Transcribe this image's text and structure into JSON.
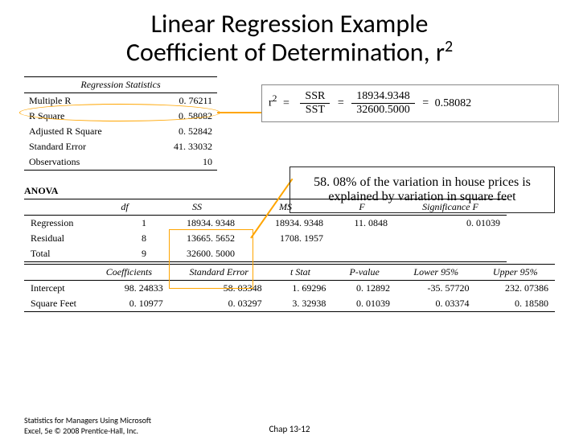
{
  "title_line1": "Linear Regression Example",
  "title_line2_a": "Coefficient of Determination, r",
  "title_line2_sup": "2",
  "stats": {
    "caption": "Regression Statistics",
    "rows": [
      {
        "label": "Multiple R",
        "value": "0. 76211"
      },
      {
        "label": "R Square",
        "value": "0. 58082"
      },
      {
        "label": "Adjusted R Square",
        "value": "0. 52842"
      },
      {
        "label": "Standard Error",
        "value": "41. 33032"
      },
      {
        "label": "Observations",
        "value": "10"
      }
    ]
  },
  "formula": {
    "r2": "r",
    "sup": "2",
    "eq": "=",
    "ssr": "SSR",
    "sst": "SST",
    "num": "18934.9348",
    "den": "32600.5000",
    "res": "0.58082"
  },
  "explain": "58. 08% of the variation in house prices is explained by variation in square feet",
  "anova": {
    "label": "ANOVA",
    "headers": [
      "df",
      "SS",
      "MS",
      "F",
      "Significance F"
    ],
    "rows": [
      {
        "label": "Regression",
        "cells": [
          "1",
          "18934. 9348",
          "18934. 9348",
          "11. 0848",
          "0. 01039"
        ]
      },
      {
        "label": "Residual",
        "cells": [
          "8",
          "13665. 5652",
          "1708. 1957",
          "",
          ""
        ]
      },
      {
        "label": "Total",
        "cells": [
          "9",
          "32600. 5000",
          "",
          "",
          ""
        ]
      }
    ]
  },
  "coef": {
    "headers": [
      "Coefficients",
      "Standard Error",
      "t Stat",
      "P-value",
      "Lower 95%",
      "Upper 95%"
    ],
    "rows": [
      {
        "label": "Intercept",
        "cells": [
          "98. 24833",
          "58. 03348",
          "1. 69296",
          "0. 12892",
          "-35. 57720",
          "232. 07386"
        ]
      },
      {
        "label": "Square Feet",
        "cells": [
          "0. 10977",
          "0. 03297",
          "3. 32938",
          "0. 01039",
          "0. 03374",
          "0. 18580"
        ]
      }
    ]
  },
  "footer": "Statistics for Managers Using Microsoft Excel, 5e © 2008 Prentice-Hall, Inc.",
  "chap": "Chap 13-12"
}
